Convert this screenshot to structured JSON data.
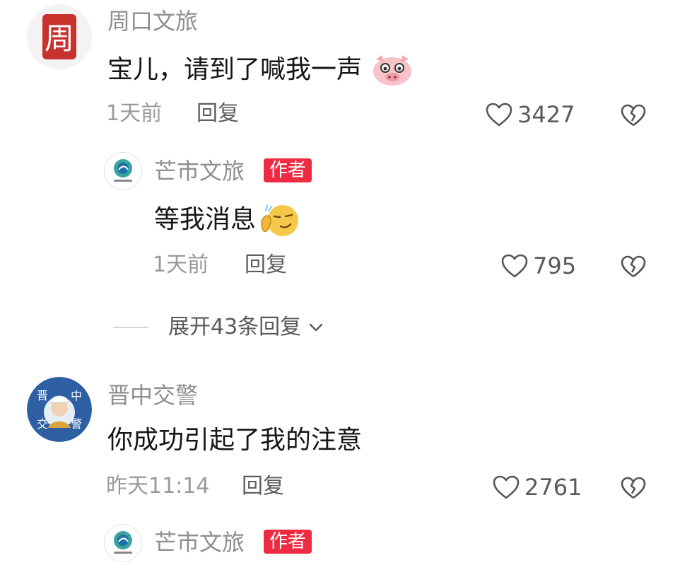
{
  "colors": {
    "author_badge": "#ee2b43",
    "username": "#8f8f8f",
    "meta": "#9a9a9a"
  },
  "comments": [
    {
      "username": "周口文旅",
      "avatar_icon": "zhoukou-seal-avatar-icon",
      "avatar_text": "周",
      "text": "宝儿，请到了喊我一声",
      "emoji": "pig-face-emoji",
      "time": "1天前",
      "reply_label": "回复",
      "likes": "3427",
      "replies": [
        {
          "username": "芒市文旅",
          "badge": "作者",
          "avatar_icon": "mangshi-peacock-logo-icon",
          "text": "等我消息",
          "emoji": "smirk-thinking-emoji",
          "time": "1天前",
          "reply_label": "回复",
          "likes": "795"
        }
      ],
      "expand_label": "展开43条回复"
    },
    {
      "username": "晋中交警",
      "avatar_icon": "jinzhong-police-avatar-icon",
      "avatar_chars": [
        "晋",
        "中",
        "交",
        "警"
      ],
      "text": "你成功引起了我的注意",
      "time": "昨天11:14",
      "reply_label": "回复",
      "likes": "2761",
      "replies": [
        {
          "username": "芒市文旅",
          "badge": "作者",
          "avatar_icon": "mangshi-peacock-logo-icon"
        }
      ]
    }
  ]
}
